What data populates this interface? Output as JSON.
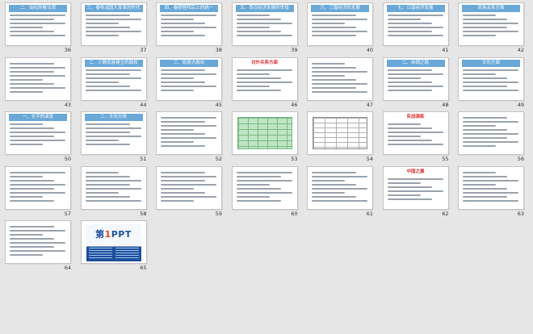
{
  "slides": [
    {
      "num": "36",
      "title": "二、仙纪的看法观",
      "title_red": false,
      "kind": "text"
    },
    {
      "num": "37",
      "title": "三、春秋战国大变革的时代",
      "title_red": false,
      "kind": "text"
    },
    {
      "num": "38",
      "title": "四、春朝怪阵后上的统一",
      "title_red": false,
      "kind": "text"
    },
    {
      "num": "39",
      "title": "五、西汉经济发展的举措",
      "title_red": false,
      "kind": "text"
    },
    {
      "num": "40",
      "title": "六、三国经济的发展",
      "title_red": false,
      "kind": "text"
    },
    {
      "num": "41",
      "title": "七、江南经济发展",
      "title_red": false,
      "kind": "text"
    },
    {
      "num": "42",
      "title": "民族关系方面",
      "title_red": false,
      "kind": "text"
    },
    {
      "num": "43",
      "title": "",
      "title_red": false,
      "kind": "text"
    },
    {
      "num": "44",
      "title": "二、少数民族建立的政权",
      "title_red": false,
      "kind": "text"
    },
    {
      "num": "45",
      "title": "三、民族大融合",
      "title_red": false,
      "kind": "text"
    },
    {
      "num": "46",
      "title": "对外关系方面",
      "title_red": true,
      "kind": "text"
    },
    {
      "num": "47",
      "title": "",
      "title_red": false,
      "kind": "text"
    },
    {
      "num": "48",
      "title": "二、丝绸之路",
      "title_red": false,
      "kind": "text"
    },
    {
      "num": "49",
      "title": "文化方面",
      "title_red": false,
      "kind": "text"
    },
    {
      "num": "50",
      "title": "一、文字的演变",
      "title_red": false,
      "kind": "text"
    },
    {
      "num": "51",
      "title": "二、文化分类",
      "title_red": false,
      "kind": "text"
    },
    {
      "num": "52",
      "title": "",
      "title_red": false,
      "kind": "text"
    },
    {
      "num": "53",
      "title": "",
      "title_red": false,
      "kind": "table"
    },
    {
      "num": "54",
      "title": "",
      "title_red": false,
      "kind": "table-white"
    },
    {
      "num": "55",
      "title": "实战演练",
      "title_red": true,
      "kind": "text"
    },
    {
      "num": "56",
      "title": "",
      "title_red": false,
      "kind": "text"
    },
    {
      "num": "57",
      "title": "",
      "title_red": false,
      "kind": "text"
    },
    {
      "num": "58",
      "title": "",
      "title_red": false,
      "kind": "text"
    },
    {
      "num": "59",
      "title": "",
      "title_red": false,
      "kind": "text"
    },
    {
      "num": "60",
      "title": "",
      "title_red": false,
      "kind": "text"
    },
    {
      "num": "61",
      "title": "",
      "title_red": false,
      "kind": "text"
    },
    {
      "num": "62",
      "title": "中国之最",
      "title_red": true,
      "kind": "text"
    },
    {
      "num": "63",
      "title": "",
      "title_red": false,
      "kind": "text"
    },
    {
      "num": "64",
      "title": "",
      "title_red": false,
      "kind": "text"
    },
    {
      "num": "65",
      "title": "",
      "title_red": false,
      "kind": "brand",
      "logo_digit": "1",
      "logo_text": "PPT",
      "logo_prefix": "第"
    }
  ]
}
